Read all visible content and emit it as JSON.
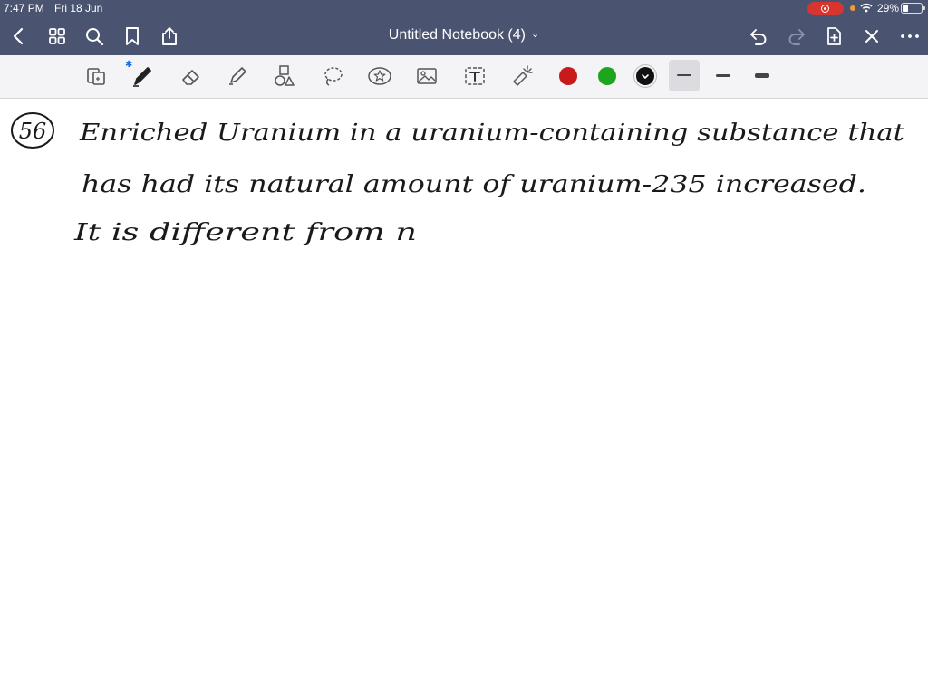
{
  "status_bar": {
    "time": "7:47 PM",
    "date": "Fri 18 Jun",
    "battery": "29%"
  },
  "nav": {
    "title": "Untitled Notebook (4)",
    "title_chevron": "⌄",
    "left_icons": [
      "back-icon",
      "grid-icon",
      "search-icon",
      "bookmark-icon",
      "share-icon"
    ],
    "right_icons": [
      "undo-icon",
      "redo-icon",
      "add-page-icon",
      "close-icon",
      "more-icon"
    ]
  },
  "toolbar": {
    "tools": [
      "lasso-select-icon",
      "pen-icon",
      "eraser-icon",
      "highlighter-icon",
      "shapes-icon",
      "lasso-icon",
      "sticker-icon",
      "image-icon",
      "text-icon",
      "laser-pointer-icon"
    ],
    "colors": [
      "#c81a1a",
      "#1ea51e",
      "#111111"
    ],
    "selected_color": "#111111",
    "stroke_sizes": [
      "thin",
      "medium",
      "thick"
    ],
    "selected_stroke": "thin"
  },
  "note": {
    "number": "56",
    "lines": [
      "Enriched Uranium in a uranium-containing substance that",
      "has had its natural amount of uranium-235 increased.",
      "It is different from n"
    ]
  }
}
